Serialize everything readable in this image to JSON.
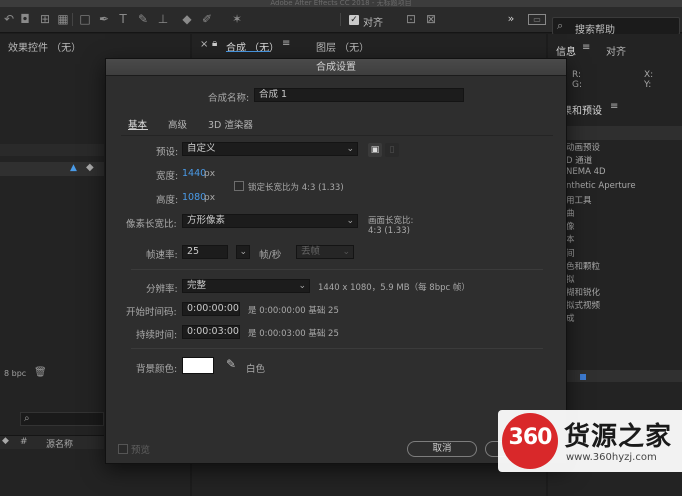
{
  "app": {
    "title": "Adobe After Effects CC 2018 - 无标题项目"
  },
  "toolbar": {
    "snap_label": "对齐",
    "search_placeholder": "搜索帮助",
    "expand": "»"
  },
  "panels": {
    "effect_controls": "效果控件 （无）",
    "composition": "合成 （无）",
    "layer": "图层 （无）",
    "info": "信息",
    "align": "对齐",
    "effects_presets": "果和预设",
    "bpc": "8 bpc",
    "source_name": "源名称",
    "hash": "#"
  },
  "info": {
    "r": "R:",
    "g": "G:",
    "x": "X:",
    "y": "Y:"
  },
  "effects_list": [
    "动画预设",
    "D 通道",
    "NEMA 4D",
    "nthetic Aperture",
    "用工具",
    "曲",
    "像",
    "本",
    "间",
    "色和颗粒",
    "拟",
    "糊和锐化",
    "拟式视频",
    "成"
  ],
  "dialog": {
    "title": "合成设置",
    "comp_name_label": "合成名称:",
    "comp_name": "合成 1",
    "tabs": [
      "基本",
      "高级",
      "3D 渲染器"
    ],
    "preset_label": "预设:",
    "preset_value": "自定义",
    "width_label": "宽度:",
    "width_value": "1440",
    "height_label": "高度:",
    "height_value": "1080",
    "px": "px",
    "lock_label": "锁定长宽比为 4:3 (1.33)",
    "pixel_aspect_label": "像素长宽比:",
    "pixel_aspect_value": "方形像素",
    "frame_aspect_label": "画面长宽比:",
    "frame_aspect_value": "4:3 (1.33)",
    "fps_label": "帧速率:",
    "fps_value": "25",
    "fps_unit": "帧/秒",
    "drop_frame": "丢帧",
    "resolution_label": "分辨率:",
    "resolution_value": "完整",
    "resolution_info": "1440 x 1080，5.9 MB（每 8bpc 帧）",
    "start_tc_label": "开始时间码:",
    "start_tc_value": "0:00:00:00",
    "start_tc_info": "是 0:00:00:00  基础 25",
    "duration_label": "持续时间:",
    "duration_value": "0:00:03:00",
    "duration_info": "是 0:00:03:00  基础 25",
    "bg_label": "背景颜色:",
    "bg_color_name": "白色",
    "bg_color": "#ffffff",
    "preview_label": "预览",
    "cancel_label": "取消"
  },
  "watermark": {
    "badge": "360",
    "name": "货源之家",
    "url": "www.360hyzj.com"
  }
}
